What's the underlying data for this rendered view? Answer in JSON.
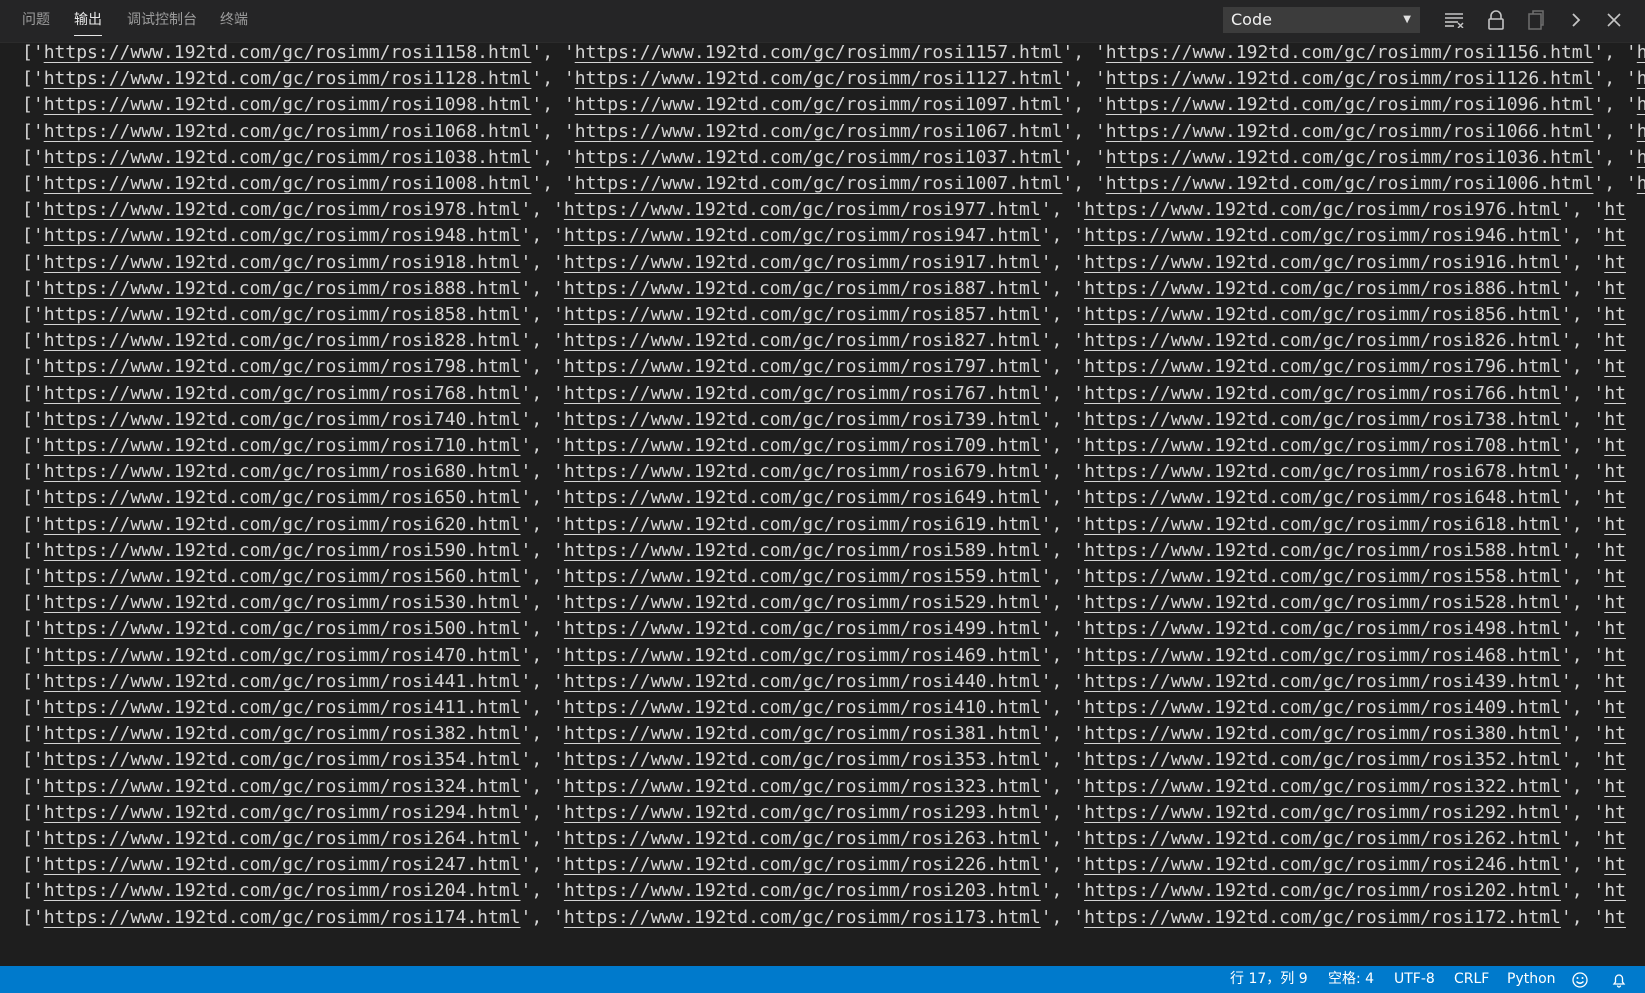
{
  "panel": {
    "tabs": [
      {
        "label": "问题",
        "active": false
      },
      {
        "label": "输出",
        "active": true
      },
      {
        "label": "调试控制台",
        "active": false
      },
      {
        "label": "终端",
        "active": false
      }
    ],
    "output_channel": "Code",
    "toolbar_icons": [
      "clear-output-icon",
      "lock-scroll-icon",
      "open-in-editor-icon",
      "chevron-right-icon",
      "close-icon"
    ]
  },
  "output": {
    "url_prefix": "https://www.192td.com/gc/rosimm/rosi",
    "url_suffix": ".html",
    "visible_trailing_fragment": "ht",
    "lines": [
      [
        1158,
        1157,
        1156
      ],
      [
        1128,
        1127,
        1126
      ],
      [
        1098,
        1097,
        1096
      ],
      [
        1068,
        1067,
        1066
      ],
      [
        1038,
        1037,
        1036
      ],
      [
        1008,
        1007,
        1006
      ],
      [
        978,
        977,
        976
      ],
      [
        948,
        947,
        946
      ],
      [
        918,
        917,
        916
      ],
      [
        888,
        887,
        886
      ],
      [
        858,
        857,
        856
      ],
      [
        828,
        827,
        826
      ],
      [
        798,
        797,
        796
      ],
      [
        768,
        767,
        766
      ],
      [
        740,
        739,
        738
      ],
      [
        710,
        709,
        708
      ],
      [
        680,
        679,
        678
      ],
      [
        650,
        649,
        648
      ],
      [
        620,
        619,
        618
      ],
      [
        590,
        589,
        588
      ],
      [
        560,
        559,
        558
      ],
      [
        530,
        529,
        528
      ],
      [
        500,
        499,
        498
      ],
      [
        470,
        469,
        468
      ],
      [
        441,
        440,
        439
      ],
      [
        411,
        410,
        409
      ],
      [
        382,
        381,
        380
      ],
      [
        354,
        353,
        352
      ],
      [
        324,
        323,
        322
      ],
      [
        294,
        293,
        292
      ],
      [
        264,
        263,
        262
      ],
      [
        247,
        226,
        246
      ],
      [
        204,
        203,
        202
      ],
      [
        174,
        173,
        172
      ]
    ]
  },
  "status_bar": {
    "position": "行 17，列 9",
    "indent": "空格: 4",
    "encoding": "UTF-8",
    "line_ending": "CRLF",
    "language": "Python",
    "icons": [
      "feedback-smiley-icon",
      "notifications-bell-icon"
    ]
  },
  "colors": {
    "background": "#1e1e1e",
    "panel_header": "#252526",
    "text": "#d4d4d4",
    "status_bar": "#007acc"
  }
}
